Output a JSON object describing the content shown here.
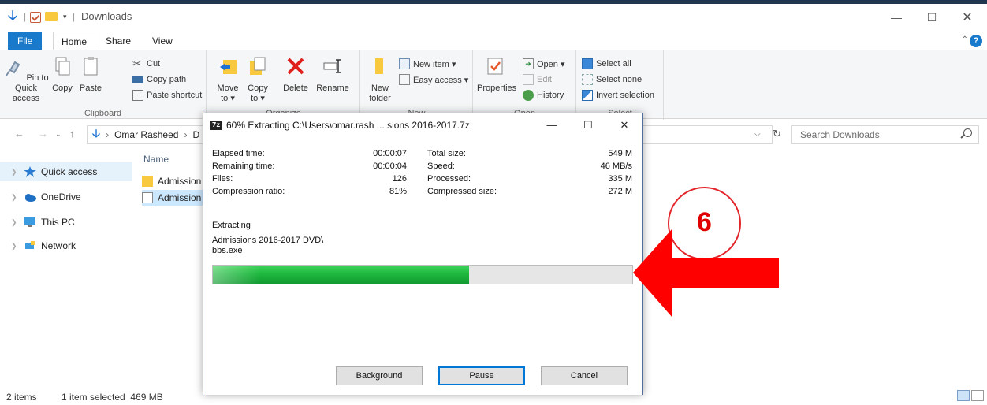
{
  "window": {
    "title": "Downloads",
    "min_glyph": "—",
    "max_glyph": "☐",
    "close_glyph": "✕"
  },
  "tabs": [
    {
      "label": "File"
    },
    {
      "label": "Home"
    },
    {
      "label": "Share"
    },
    {
      "label": "View"
    }
  ],
  "ribbon": {
    "clipboard": {
      "label": "Clipboard",
      "pin": "Pin to Quick access",
      "copy": "Copy",
      "paste": "Paste",
      "cut": "Cut",
      "copy_path": "Copy path",
      "paste_shortcut": "Paste shortcut"
    },
    "organize": {
      "label": "Organize",
      "move_to": "Move to ▾",
      "copy_to": "Copy to ▾",
      "delete": "Delete",
      "rename": "Rename"
    },
    "new": {
      "label": "New",
      "new_folder": "New folder",
      "new_item": "New item ▾",
      "easy_access": "Easy access ▾"
    },
    "open": {
      "label": "Open",
      "properties": "Properties",
      "open": "Open ▾",
      "edit": "Edit",
      "history": "History"
    },
    "select": {
      "label": "Select",
      "select_all": "Select all",
      "select_none": "Select none",
      "invert": "Invert selection"
    }
  },
  "address": {
    "crumbs": [
      "Omar Rasheed",
      "D"
    ],
    "search_placeholder": "Search Downloads"
  },
  "nav_pane": {
    "items": [
      {
        "label": "Quick access"
      },
      {
        "label": "OneDrive"
      },
      {
        "label": "This PC"
      },
      {
        "label": "Network"
      }
    ]
  },
  "file_list": {
    "column_name": "Name",
    "rows": [
      {
        "name": "Admission"
      },
      {
        "name": "Admission"
      }
    ]
  },
  "status_bar": {
    "items": "2 items",
    "selection": "1 item selected  469 MB"
  },
  "dialog": {
    "title": "60% Extracting C:\\Users\\omar.rash ... sions 2016-2017.7z",
    "icon_text": "7z",
    "stats_left": [
      {
        "label": "Elapsed time:",
        "value": "00:00:07"
      },
      {
        "label": "Remaining time:",
        "value": "00:00:04"
      },
      {
        "label": "Files:",
        "value": "126"
      },
      {
        "label": "Compression ratio:",
        "value": "81%"
      }
    ],
    "stats_right": [
      {
        "label": "Total size:",
        "value": "549 M"
      },
      {
        "label": "Speed:",
        "value": "46 MB/s"
      },
      {
        "label": "Processed:",
        "value": "335 M"
      },
      {
        "label": "Compressed size:",
        "value": "272 M"
      }
    ],
    "status_label": "Extracting",
    "current_path": "Admissions 2016-2017 DVD\\",
    "current_file": "bbs.exe",
    "progress_percent": 61,
    "buttons": {
      "background": "Background",
      "pause": "Pause",
      "cancel": "Cancel"
    }
  },
  "annotation": {
    "step_number": "6",
    "arrow_color": "#ff0000",
    "circle_color": "#e3262b"
  }
}
